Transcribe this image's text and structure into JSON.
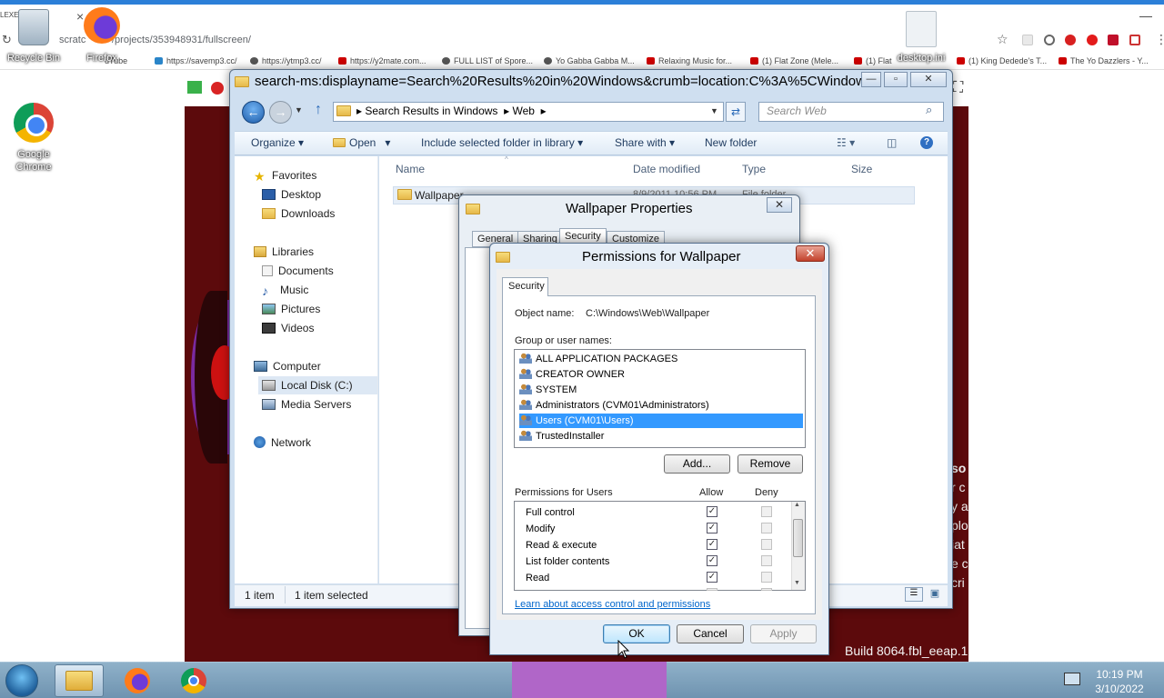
{
  "browser": {
    "address_text": "scratc...tv/ (1) ... /projects/353948931/fullscreen/",
    "address_partial": "/projects/353948931/fullscreen/",
    "bookmarks": [
      "https://savemp3.cc/",
      "https://ytmp3.cc/",
      "https://y2mate.com...",
      "FULL LIST of Spore...",
      "Yo Gabba Gabba M...",
      "Relaxing Music for...",
      "(1) Flat Zone (Mele...",
      "(1) Flat",
      "(1) King Dedede's T...",
      "The Yo Dazzlers - Y..."
    ],
    "youtube_partial": "uTube"
  },
  "desktop": {
    "recycle_label": "Recycle Bin",
    "firefox_label": "Firefox",
    "chrome_label": "Google Chrome",
    "ini_label": "desktop.ini",
    "exe_label": "LEXE"
  },
  "stage": {
    "build_text": "Build 8064.fbl_eeap.1",
    "snippets": [
      "so",
      "r c",
      "y a",
      "plo",
      "iat",
      "e c",
      "cri"
    ]
  },
  "explorer": {
    "title": "search-ms:displayname=Search%20Results%20in%20Windows&crumb=location:C%3A%5CWindow...",
    "breadcrumb": [
      "Search Results in Windows",
      "Web"
    ],
    "search_placeholder": "Search Web",
    "toolbar": {
      "organize": "Organize",
      "open": "Open",
      "include": "Include selected folder in library",
      "share": "Share with",
      "new_folder": "New folder"
    },
    "nav": {
      "favorites": "Favorites",
      "desktop": "Desktop",
      "downloads": "Downloads",
      "libraries": "Libraries",
      "documents": "Documents",
      "music": "Music",
      "pictures": "Pictures",
      "videos": "Videos",
      "computer": "Computer",
      "local_disk": "Local Disk (C:)",
      "media_servers": "Media Servers",
      "network": "Network"
    },
    "columns": [
      "Name",
      "Date modified",
      "Type",
      "Size"
    ],
    "row": {
      "name": "Wallpaper",
      "date": "8/9/2011 10:56 PM",
      "type": "File folder"
    },
    "status": {
      "count": "1 item",
      "selected": "1 item selected"
    }
  },
  "props": {
    "title": "Wallpaper Properties",
    "tabs": [
      "General",
      "Sharing",
      "Security",
      "Customize"
    ]
  },
  "perm": {
    "title": "Permissions for Wallpaper",
    "tab": "Security",
    "object_label": "Object name:",
    "object_value": "C:\\Windows\\Web\\Wallpaper",
    "group_label": "Group or user names:",
    "users": [
      "ALL APPLICATION PACKAGES",
      "CREATOR OWNER",
      "SYSTEM",
      "Administrators (CVM01\\Administrators)",
      "Users (CVM01\\Users)",
      "TrustedInstaller"
    ],
    "selected_user_index": 4,
    "add": "Add...",
    "remove": "Remove",
    "permissions_label": "Permissions for Users",
    "allow": "Allow",
    "deny": "Deny",
    "permissions": [
      {
        "name": "Full control",
        "allow": true,
        "deny": false
      },
      {
        "name": "Modify",
        "allow": true,
        "deny": false
      },
      {
        "name": "Read & execute",
        "allow": true,
        "deny": false
      },
      {
        "name": "List folder contents",
        "allow": true,
        "deny": false
      },
      {
        "name": "Read",
        "allow": true,
        "deny": false
      }
    ],
    "link": "Learn about access control and permissions",
    "ok": "OK",
    "cancel": "Cancel",
    "apply": "Apply"
  },
  "clock": {
    "time": "10:19 PM",
    "date": "3/10/2022"
  }
}
